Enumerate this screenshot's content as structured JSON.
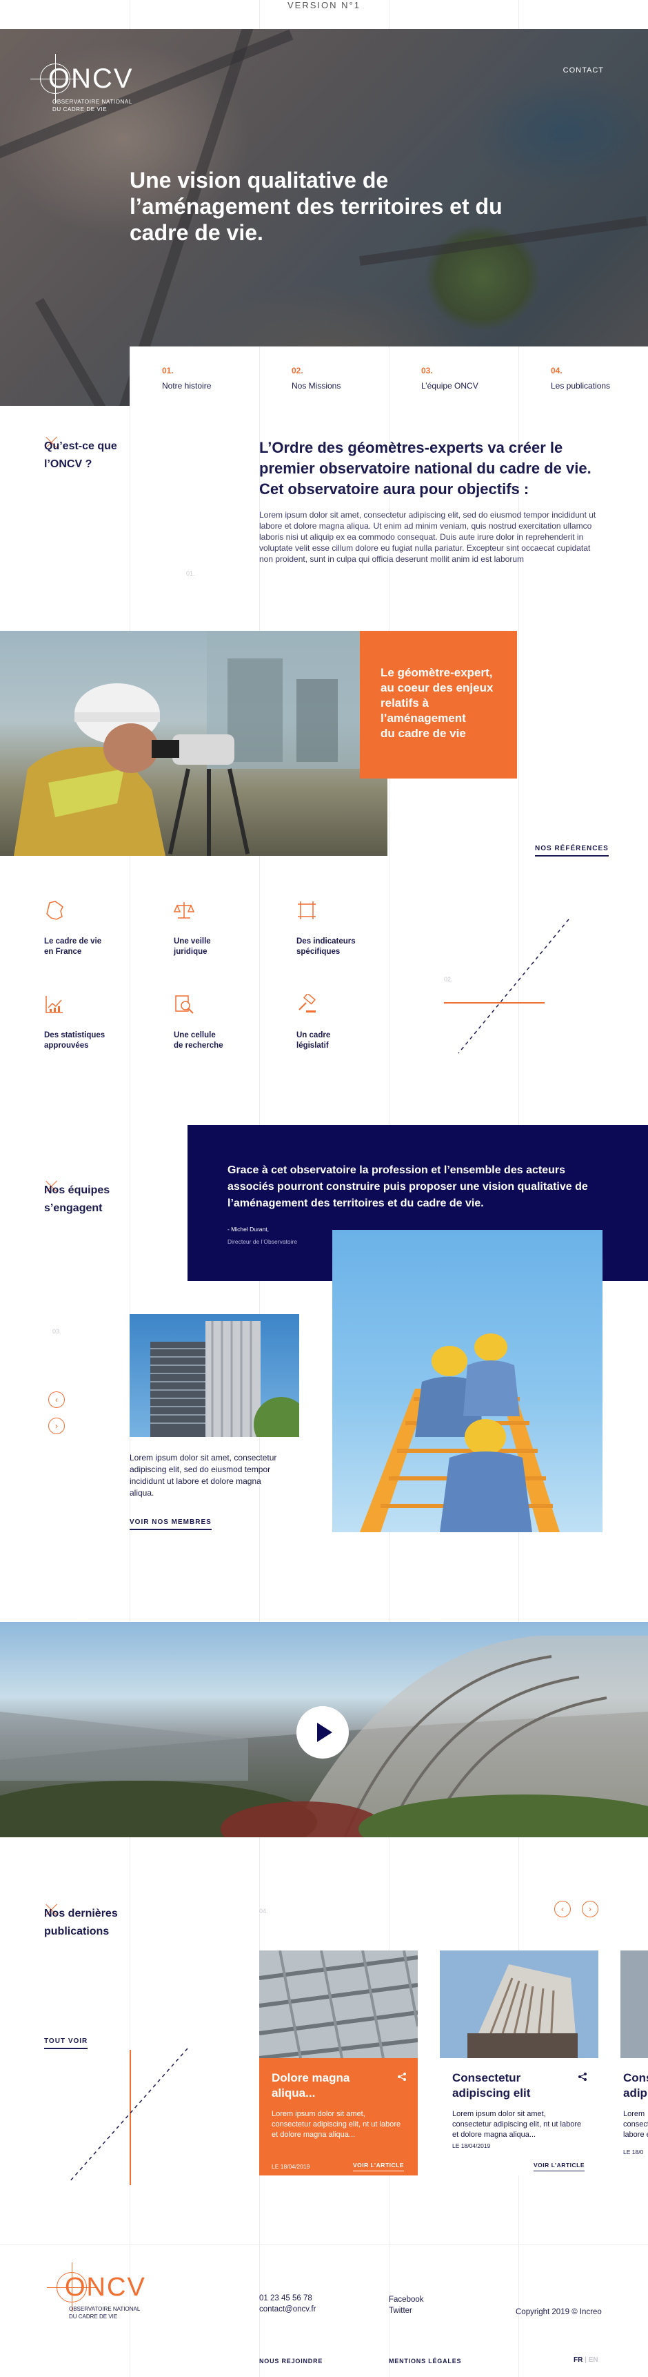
{
  "version_label": "VERSION N°1",
  "header": {
    "logo_text": "ONCV",
    "logo_subtitle_1": "OBSERVATOIRE NATIONAL",
    "logo_subtitle_2": "DU CADRE DE VIE",
    "contact_label": "CONTACT"
  },
  "hero": {
    "title": "Une vision qualitative de l’aménagement des territoires et du cadre de vie."
  },
  "nav": [
    {
      "num": "01.",
      "label": "Notre histoire"
    },
    {
      "num": "02.",
      "label": "Nos Missions"
    },
    {
      "num": "03.",
      "label": "L’équipe ONCV"
    },
    {
      "num": "04.",
      "label": "Les publications"
    }
  ],
  "about": {
    "label_line1": "Qu’est-ce que",
    "label_line2": "l’ONCV ?",
    "section_num": "01.",
    "heading": "L’Ordre des géomètres-experts va créer le premier observatoire national du cadre de vie. Cet observatoire aura pour objectifs :",
    "body": "Lorem ipsum dolor sit amet, consectetur adipiscing elit, sed do eiusmod tempor incididunt ut labore et dolore magna aliqua. Ut enim ad minim veniam, quis nostrud exercitation ullamco laboris nisi ut aliquip ex ea commodo consequat. Duis aute irure dolor in reprehenderit in voluptate velit esse cillum dolore eu fugiat nulla pariatur. Excepteur sint occaecat cupidatat non proident, sunt in culpa qui officia deserunt mollit anim id est laborum"
  },
  "surveyor": {
    "box_line1": "Le géomètre-expert,",
    "box_line2": "au coeur des enjeux",
    "box_line3": "relatifs à",
    "box_line4": "l’aménagement",
    "box_line5": "du cadre de vie",
    "references_link": "NOS RÉFÉRENCES"
  },
  "features": {
    "section_num": "02.",
    "items": [
      {
        "line1": "Le cadre de vie",
        "line2": "en France",
        "icon": "france-map-icon"
      },
      {
        "line1": "Une veille",
        "line2": "juridique",
        "icon": "scales-icon"
      },
      {
        "line1": "Des indicateurs",
        "line2": "spécifiques",
        "icon": "frame-icon"
      },
      {
        "line1": "Des statistiques",
        "line2": "approuvées",
        "icon": "chart-icon"
      },
      {
        "line1": "Une cellule",
        "line2": "de recherche",
        "icon": "research-icon"
      },
      {
        "line1": "Un cadre",
        "line2": "législatif",
        "icon": "gavel-icon"
      }
    ]
  },
  "team": {
    "label_line1": "Nos équipes",
    "label_line2": "s’engagent",
    "section_num": "03.",
    "quote": "Grace à cet observatoire la profession et l’ensemble des acteurs associés pourront construire puis proposer une vision qualitative de l’aménagement des territoires et du cadre de vie.",
    "quote_author": "- Michel Durant,",
    "quote_role": "Directeur de l’Observatoire",
    "body": "Lorem ipsum dolor sit amet, consectetur adipiscing elit, sed do eiusmod tempor incididunt ut labore et dolore magna aliqua.",
    "members_link": "VOIR NOS MEMBRES"
  },
  "publications": {
    "label_line1": "Nos dernières",
    "label_line2": "publications",
    "section_num": "04.",
    "see_all": "TOUT VOIR",
    "cards": [
      {
        "title": "Dolore magna aliqua...",
        "text": "Lorem ipsum dolor sit amet, consectetur adipiscing elit, nt ut labore et dolore magna aliqua...",
        "date": "LE 18/04/2019",
        "link": "VOIR L’ARTICLE"
      },
      {
        "title": "Consectetur adipiscing elit",
        "text": "Lorem ipsum dolor sit amet, consectetur adipiscing elit, nt ut labore et dolore magna aliqua...",
        "date": "LE 18/04/2019",
        "link": "VOIR L’ARTICLE"
      },
      {
        "title": "Cons adip",
        "text": "Lorem consecte labore e",
        "date": "LE 18/0",
        "link": ""
      }
    ]
  },
  "footer": {
    "logo_text": "ONCV",
    "logo_subtitle_1": "OBSERVATOIRE NATIONAL",
    "logo_subtitle_2": "DU CADRE DE VIE",
    "phone": "01 23 45 56 78",
    "email": "contact@oncv.fr",
    "facebook": "Facebook",
    "twitter": "Twitter",
    "copyright": "Copyright 2019 © Increo",
    "join": "NOUS REJOINDRE",
    "legal": "MENTIONS LÉGALES",
    "lang_fr": "FR",
    "lang_sep": "|",
    "lang_en": "EN"
  },
  "colors": {
    "navy": "#1b1a4f",
    "deep_navy": "#0c0a54",
    "orange": "#f26f32"
  }
}
